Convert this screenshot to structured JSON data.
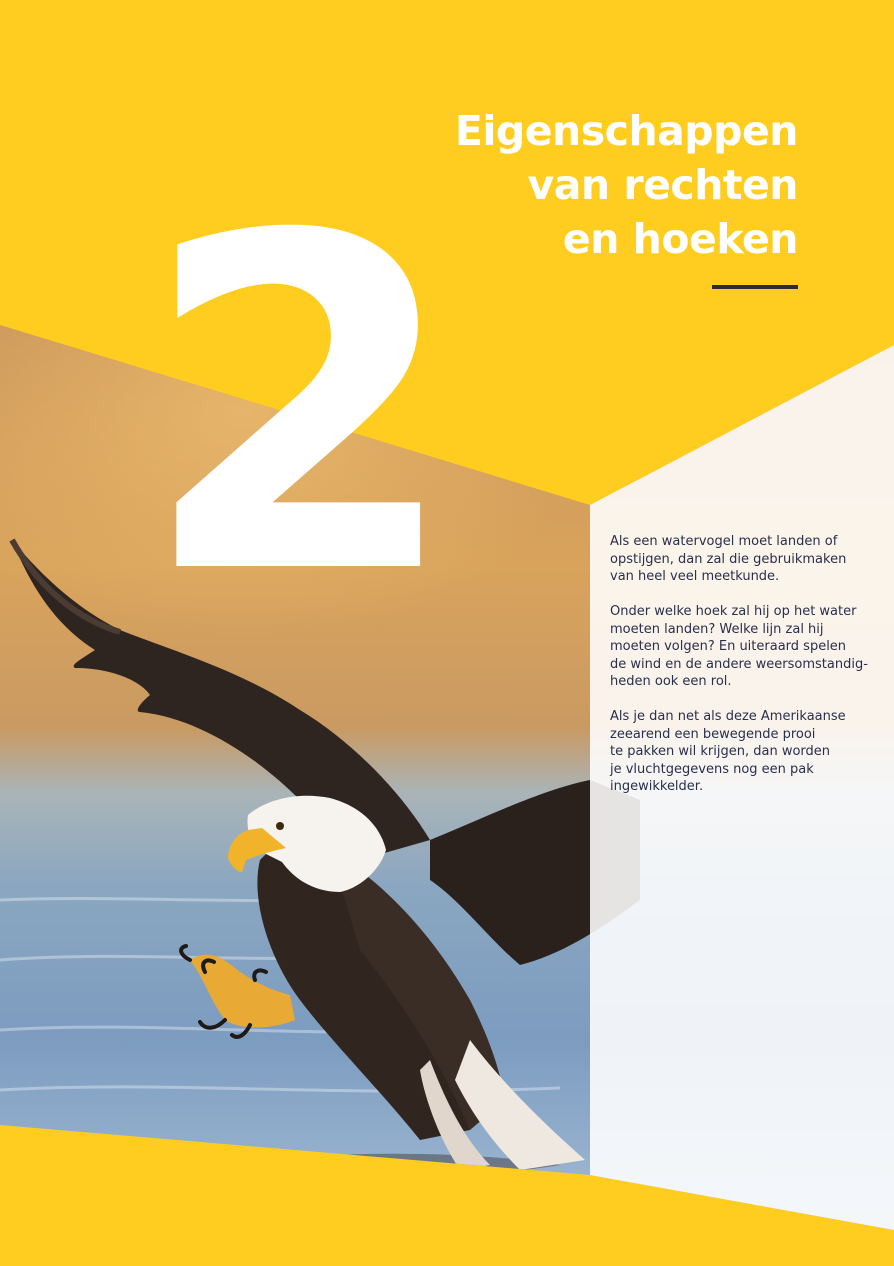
{
  "colors": {
    "yellow": "#fecd1f",
    "white": "#ffffff",
    "rule": "#2c2a35",
    "text": "#2a2f4a"
  },
  "chapter": {
    "number": "2"
  },
  "title": {
    "lines": [
      "Eigenschappen",
      "van rechten",
      "en hoeken"
    ]
  },
  "intro": {
    "paragraphs": [
      [
        "Als een watervogel moet landen of",
        "opstijgen, dan zal die gebruikmaken",
        "van heel veel meetkunde."
      ],
      [
        "Onder welke hoek zal hij op het water",
        "moeten landen? Welke lijn zal hij",
        "moeten volgen? En uiteraard spelen",
        "de wind en de andere weersomstandig-",
        "heden ook een rol."
      ],
      [
        "Als je dan net als deze Amerikaanse",
        "zeearend een bewegende prooi",
        "te pakken wil krijgen, dan worden",
        "je vluchtgegevens nog een pak",
        "ingewikkelder."
      ]
    ]
  },
  "photo": {
    "subject": "bald-eagle-landing-on-water"
  }
}
